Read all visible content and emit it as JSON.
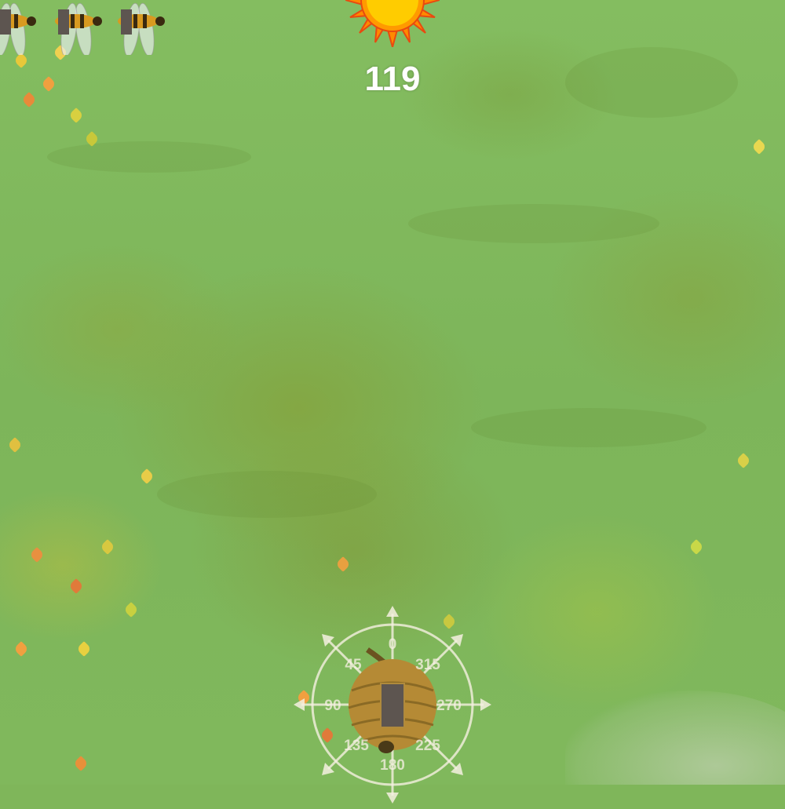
{
  "hud": {
    "timer_value": "119",
    "lives_remaining": 3
  },
  "compass": {
    "labels": {
      "n": "0",
      "ne": "315",
      "e": "270",
      "se": "225",
      "s": "180",
      "sw": "135",
      "w": "90",
      "nw": "45"
    }
  },
  "icons": {
    "sun": "sun-icon",
    "bee": "bee-life-icon",
    "hive": "beehive-icon",
    "compass": "compass-icon"
  },
  "colors": {
    "grass": "#7fb65a",
    "sun_core": "#ffcc00",
    "sun_rays": "#ff6a00",
    "timer_text": "#ffffff",
    "dial": "#f0ecd8",
    "hive": "#b58a35",
    "hive_gate": "#5d5550"
  }
}
